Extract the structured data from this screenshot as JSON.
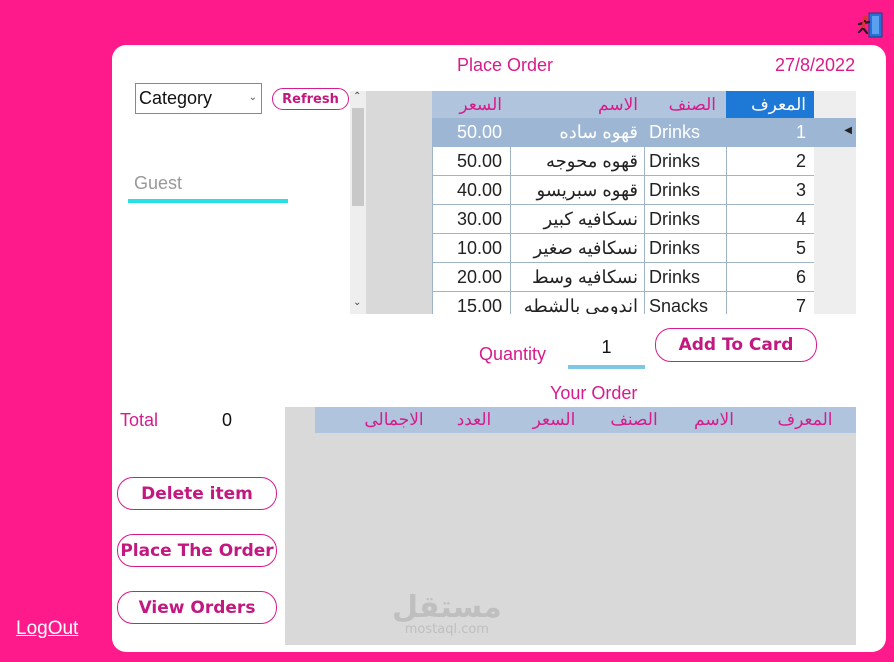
{
  "window": {
    "exit_icon": "running-man-exit-icon",
    "logout_label": "LogOut"
  },
  "header": {
    "title": "Place Order",
    "date": "27/8/2022"
  },
  "filters": {
    "category_selected": "Category",
    "refresh_label": "Refresh",
    "customer_placeholder": "Guest"
  },
  "products": {
    "columns": {
      "id": "المعرف",
      "category": "الصنف",
      "name": "الاسم",
      "price": "السعر"
    },
    "rows": [
      {
        "id": "1",
        "category": "Drinks",
        "name": "قهوه ساده",
        "price": "50.00"
      },
      {
        "id": "2",
        "category": "Drinks",
        "name": "قهوه محوجه",
        "price": "50.00"
      },
      {
        "id": "3",
        "category": "Drinks",
        "name": "قهوه سبريسو",
        "price": "40.00"
      },
      {
        "id": "4",
        "category": "Drinks",
        "name": "نسكافيه كبير",
        "price": "30.00"
      },
      {
        "id": "5",
        "category": "Drinks",
        "name": "نسكافيه صغير",
        "price": "10.00"
      },
      {
        "id": "6",
        "category": "Drinks",
        "name": "نسكافيه وسط",
        "price": "20.00"
      },
      {
        "id": "7",
        "category": "Snacks",
        "name": "اندومي بالشطه",
        "price": "15.00"
      }
    ]
  },
  "quantity": {
    "label": "Quantity",
    "value": "1"
  },
  "add_button_label": "Add To Card",
  "order": {
    "title": "Your Order",
    "total_label": "Total",
    "total_value": "0",
    "columns": [
      "المعرف",
      "الاسم",
      "الصنف",
      "السعر",
      "العدد",
      "الاجمالى"
    ]
  },
  "actions": {
    "delete_label": "Delete item",
    "place_label": "Place The Order",
    "view_label": "View Orders"
  },
  "watermark": {
    "arabic": "مستقل",
    "latin": "mostaql.com"
  },
  "colors": {
    "background": "#ff1a8c",
    "accent_text": "#d81b8c",
    "grid_header": "#b0c4de",
    "selected_row": "#9db6d4",
    "id_header": "#1e78d6",
    "guest_underline": "#26e0e6"
  }
}
